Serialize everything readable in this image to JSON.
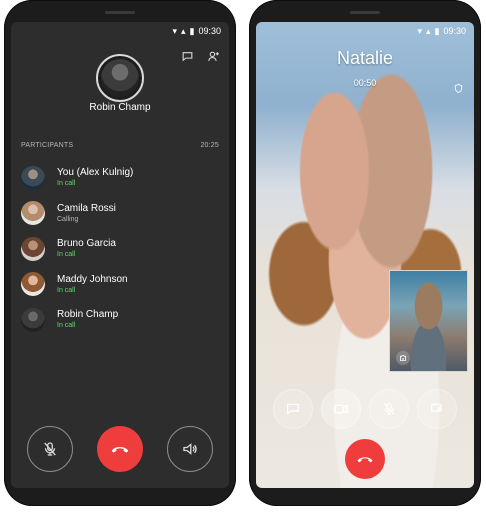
{
  "left_phone": {
    "status_time": "09:30",
    "host_name": "Robin Champ",
    "participants_label": "PARTICIPANTS",
    "duration": "20:25",
    "participants": [
      {
        "name": "You (Alex Kulnig)",
        "status": "In call"
      },
      {
        "name": "Camila Rossi",
        "status": "Calling"
      },
      {
        "name": "Bruno Garcia",
        "status": "In call"
      },
      {
        "name": "Maddy Johnson",
        "status": "In call"
      },
      {
        "name": "Robin Champ",
        "status": "In call"
      }
    ]
  },
  "right_phone": {
    "status_time": "09:30",
    "caller_name": "Natalie",
    "timer": "00:50"
  },
  "colors": {
    "end_call": "#ef3d3d",
    "in_call": "#62d96b"
  },
  "icons": [
    "chat-icon",
    "add-participant-icon",
    "mic-off-icon",
    "end-call-icon",
    "speaker-icon",
    "video-icon",
    "camera-switch-icon",
    "shield-icon"
  ]
}
